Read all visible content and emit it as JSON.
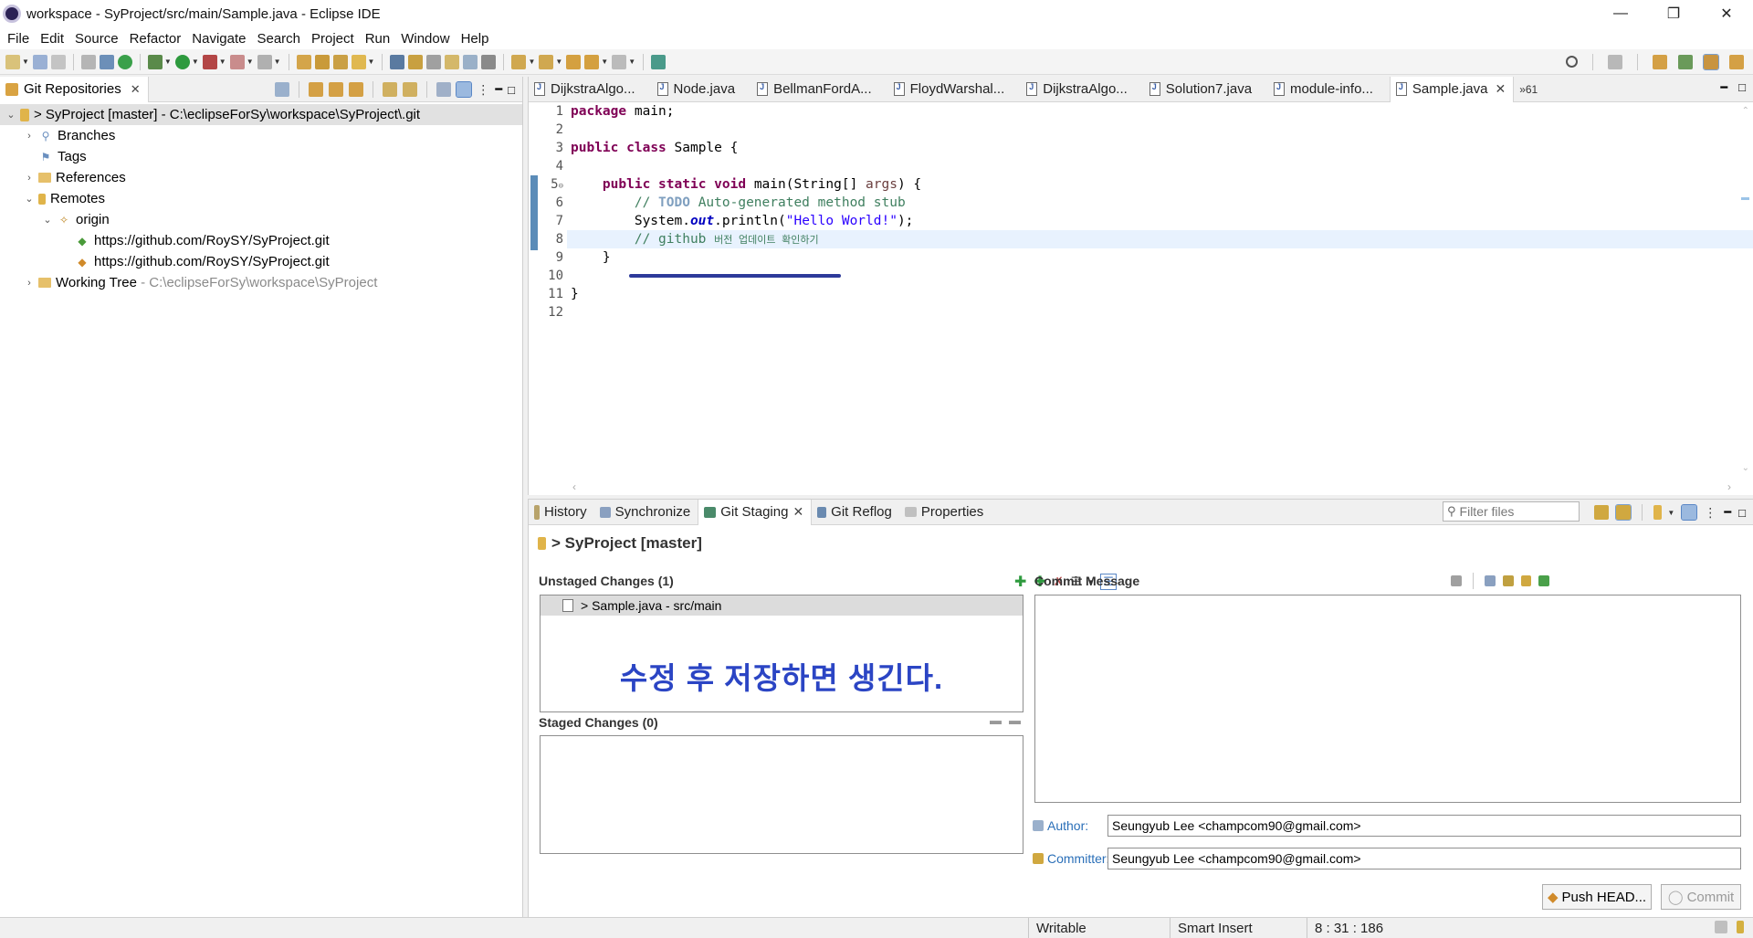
{
  "window": {
    "title": "workspace - SyProject/src/main/Sample.java - Eclipse IDE"
  },
  "menu": [
    {
      "label": "File"
    },
    {
      "label": "Edit"
    },
    {
      "label": "Source"
    },
    {
      "label": "Refactor"
    },
    {
      "label": "Navigate"
    },
    {
      "label": "Search"
    },
    {
      "label": "Project"
    },
    {
      "label": "Run"
    },
    {
      "label": "Window"
    },
    {
      "label": "Help"
    }
  ],
  "git_repositories": {
    "tab_label": "Git Repositories",
    "tree": {
      "repo": "> SyProject [master] - C:\\eclipseForSy\\workspace\\SyProject\\.git",
      "branches": "Branches",
      "tags": "Tags",
      "references": "References",
      "remotes": "Remotes",
      "origin": "origin",
      "fetch_url": "https://github.com/RoySY/SyProject.git",
      "push_url": "https://github.com/RoySY/SyProject.git",
      "working_tree": "Working Tree",
      "working_tree_path": "- C:\\eclipseForSy\\workspace\\SyProject"
    }
  },
  "editor": {
    "tabs": [
      {
        "label": "DijkstraAlgo..."
      },
      {
        "label": "Node.java"
      },
      {
        "label": "BellmanFordA..."
      },
      {
        "label": "FloydWarshal..."
      },
      {
        "label": "DijkstraAlgo..."
      },
      {
        "label": "Solution7.java"
      },
      {
        "label": "module-info..."
      },
      {
        "label": "Sample.java"
      }
    ],
    "overflow": "»61",
    "line_numbers": [
      "1",
      "2",
      "3",
      "4",
      "5",
      "6",
      "7",
      "8",
      "9",
      "10",
      "11",
      "12"
    ],
    "code": {
      "l1_kw": "package",
      "l1_rest": " main;",
      "l3_kw1": "public",
      "l3_kw2": "class",
      "l3_rest": " Sample {",
      "l5_kw1": "public",
      "l5_kw2": "static",
      "l5_kw3": "void",
      "l5_rest1": " main(String[] ",
      "l5_param": "args",
      "l5_rest2": ") {",
      "l6_comment_a": "// ",
      "l6_todo": "TODO",
      "l6_comment_b": " Auto-generated method stub",
      "l7_a": "System.",
      "l7_field": "out",
      "l7_b": ".println(",
      "l7_str": "\"Hello World!\"",
      "l7_c": ");",
      "l8_comment": "// github ",
      "l8_korean": "버전 업데이트 확인하기",
      "l9": "    }",
      "l11": "}"
    }
  },
  "bottom": {
    "tabs": [
      {
        "label": "History"
      },
      {
        "label": "Synchronize"
      },
      {
        "label": "Git Staging"
      },
      {
        "label": "Git Reflog"
      },
      {
        "label": "Properties"
      }
    ],
    "filter_placeholder": "Filter files",
    "repo_header": "> SyProject [master]",
    "unstaged_label": "Unstaged Changes (1)",
    "unstaged_item": "> Sample.java - src/main",
    "annotation": "수정 후 저장하면 생긴다.",
    "staged_label": "Staged Changes (0)",
    "commit_message_label": "Commit Message",
    "author_label": "Author:",
    "author_value": "Seungyub Lee <champcom90@gmail.com>",
    "committer_label": "Committer:",
    "committer_value": "Seungyub Lee <champcom90@gmail.com>",
    "push_button": "Push HEAD...",
    "commit_button": "Commit"
  },
  "status": {
    "mode": "Writable",
    "insert": "Smart Insert",
    "position": "8 : 31 : 186"
  },
  "colors": {
    "annotation_blue": "#2b45c4",
    "keyword": "#7f0055",
    "comment": "#3f7f5f",
    "string": "#2a00ff",
    "current_line": "#e8f2fe"
  }
}
